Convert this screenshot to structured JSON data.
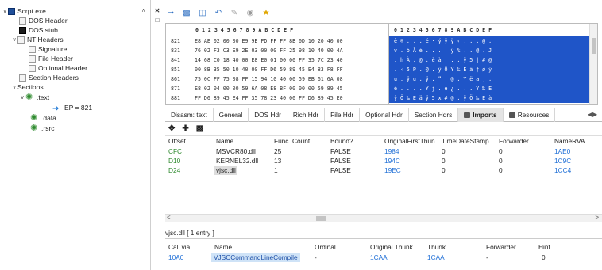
{
  "tree": {
    "root": "Scrpt.exe",
    "dos_header": "DOS Header",
    "dos_stub": "DOS stub",
    "nt_headers": "NT Headers",
    "signature": "Signature",
    "file_header": "File Header",
    "optional_header": "Optional Header",
    "section_headers": "Section Headers",
    "sections": "Sections",
    "text": ".text",
    "ep": "EP = 821",
    "data": ".data",
    "rsrc": ".rsrc"
  },
  "hex": {
    "header": "0 1 2 3 4 5 6 7 8 9 A B C D E F",
    "rows": [
      {
        "addr": "821",
        "bytes": "E8 AE 02 00 00 E9 9E FD FF FF 8B 0D 10 20 40 00",
        "ascii": "è ® . . . é · ý ÿ ÿ ‹ . . . @ ."
      },
      {
        "addr": "831",
        "bytes": "76 02 F3 C3 E9 2E 03 00 00 FF 25 98 10 40 00 4A",
        "ascii": "v . ó Ã é . . . . ÿ % . . @ . J"
      },
      {
        "addr": "841",
        "bytes": "14 68 C0 18 40 00 E8 E0 01 00 00 FF 35 7C 23 40",
        "ascii": ". h À . @ . è à . . . ÿ 5 | # @"
      },
      {
        "addr": "851",
        "bytes": "00 8B 35 50 10 40 00 FF D6 59 89 45 E4 83 F8 FF",
        "ascii": ". ‹ 5 P . @ . ÿ Ö Y ‰ E ä ƒ ø ÿ"
      },
      {
        "addr": "861",
        "bytes": "75 0C FF 75 08 FF 15 94 10 40 00 59 EB 61 6A 08",
        "ascii": "u . ÿ u . ÿ . ” . @ . Y ë a j ."
      },
      {
        "addr": "871",
        "bytes": "E8 02 04 00 00 59 6A 08 E8 BF 00 00 00 59 89 45",
        "ascii": "è . . . . Y j . è ¿ . . . Y ‰ E"
      },
      {
        "addr": "881",
        "bytes": "FF D6 89 45 E4 FF 35 78 23 40 00 FF D6 89 45 E0",
        "ascii": "ÿ Ö ‰ E ä ÿ 5 x # @ . ÿ Ö ‰ E à"
      }
    ]
  },
  "tabs": [
    "Disasm: text",
    "General",
    "DOS Hdr",
    "Rich Hdr",
    "File Hdr",
    "Optional Hdr",
    "Section Hdrs",
    "Imports",
    "Resources"
  ],
  "active_tab": "Imports",
  "imports": {
    "columns": [
      "Offset",
      "Name",
      "Func. Count",
      "Bound?",
      "OriginalFirstThun",
      "TimeDateStamp",
      "Forwarder",
      "NameRVA"
    ],
    "rows": [
      {
        "offset": "CFC",
        "name": "MSVCR80.dll",
        "count": "25",
        "bound": "FALSE",
        "oft": "1984",
        "tds": "0",
        "fwd": "0",
        "rva": "1AE0"
      },
      {
        "offset": "D10",
        "name": "KERNEL32.dll",
        "count": "13",
        "bound": "FALSE",
        "oft": "194C",
        "tds": "0",
        "fwd": "0",
        "rva": "1C9C"
      },
      {
        "offset": "D24",
        "name": "vjsc.dll",
        "count": "1",
        "bound": "FALSE",
        "oft": "19EC",
        "tds": "0",
        "fwd": "0",
        "rva": "1CC4"
      }
    ]
  },
  "functions": {
    "caption": "vjsc.dll   [ 1 entry ]",
    "columns": [
      "Call via",
      "Name",
      "Ordinal",
      "Original Thunk",
      "Thunk",
      "Forwarder",
      "Hint"
    ],
    "rows": [
      {
        "callvia": "10A0",
        "name": "VJSCCommandLineCompile",
        "ordinal": "-",
        "othunk": "1CAA",
        "thunk": "1CAA",
        "fwd": "-",
        "hint": "0"
      }
    ]
  },
  "colors": {
    "selection": "#1f55c8",
    "accent": "#1e6ed6",
    "green": "#2e8a2e"
  }
}
